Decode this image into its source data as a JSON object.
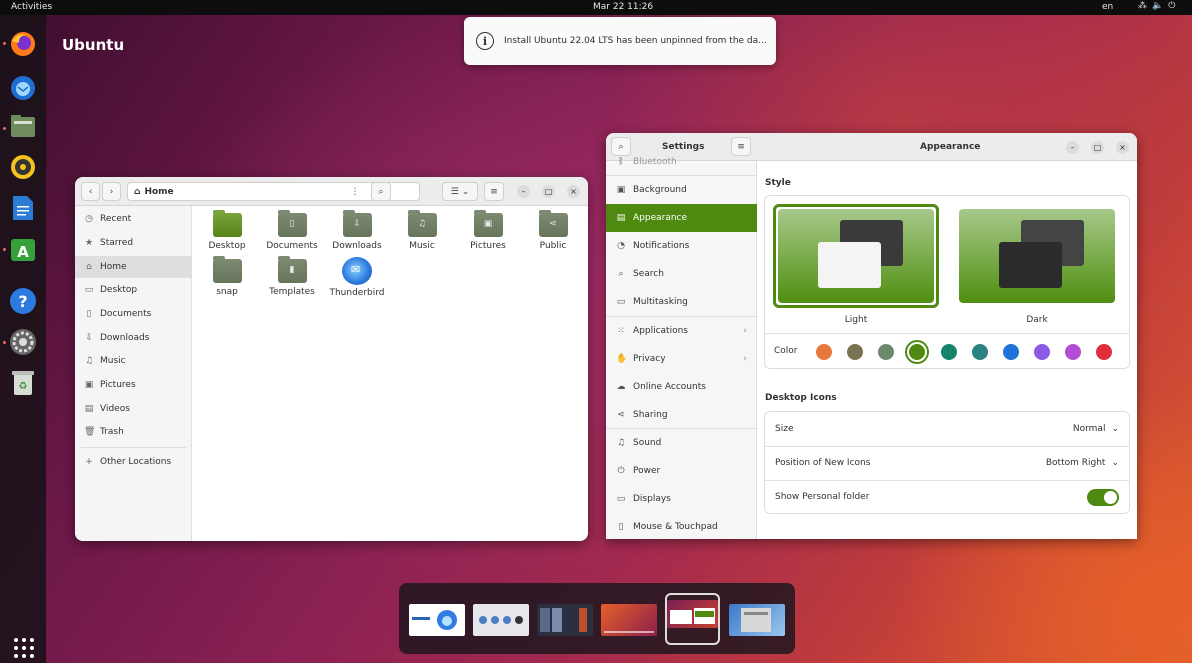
{
  "topbar": {
    "activities": "Activities",
    "clock": "Mar 22  11:26",
    "lang": "en",
    "tray_icons": [
      "network-icon",
      "volume-icon",
      "power-icon"
    ]
  },
  "desktop": {
    "title": "Ubuntu"
  },
  "dock": {
    "apps": [
      "firefox-icon",
      "thunderbird-icon",
      "files-icon",
      "rhythmbox-icon",
      "writer-icon",
      "app-center-icon",
      "help-icon",
      "settings-icon",
      "trash-icon"
    ]
  },
  "notification": {
    "text": "Install Ubuntu 22.04 LTS has been unpinned from the da..."
  },
  "files": {
    "path": "Home",
    "sidebar": [
      {
        "label": "Recent",
        "icon": "clock-icon"
      },
      {
        "label": "Starred",
        "icon": "star-icon"
      },
      {
        "label": "Home",
        "icon": "home-icon"
      },
      {
        "label": "Desktop",
        "icon": "desktop-icon"
      },
      {
        "label": "Documents",
        "icon": "document-icon"
      },
      {
        "label": "Downloads",
        "icon": "download-icon"
      },
      {
        "label": "Music",
        "icon": "music-icon"
      },
      {
        "label": "Pictures",
        "icon": "picture-icon"
      },
      {
        "label": "Videos",
        "icon": "video-icon"
      },
      {
        "label": "Trash",
        "icon": "trash-icon"
      },
      {
        "label": "Other Locations",
        "icon": "plus-icon"
      }
    ],
    "items": [
      "Desktop",
      "Documents",
      "Downloads",
      "Music",
      "Pictures",
      "Public",
      "snap",
      "Templates",
      "Thunderbird"
    ]
  },
  "settings": {
    "title": "Settings",
    "page_title": "Appearance",
    "nav": [
      "Bluetooth",
      "Background",
      "Appearance",
      "Notifications",
      "Search",
      "Multitasking",
      "Applications",
      "Privacy",
      "Online Accounts",
      "Sharing",
      "Sound",
      "Power",
      "Displays",
      "Mouse & Touchpad"
    ],
    "style_label": "Style",
    "themes": [
      "Light",
      "Dark"
    ],
    "selected_theme": "Light",
    "color_label": "Color",
    "colors": [
      "#e8773c",
      "#77744f",
      "#6b8a6b",
      "#4e8a0f",
      "#13846a",
      "#2d8286",
      "#1f72d6",
      "#8a5ae6",
      "#b34cd4",
      "#de2e3e"
    ],
    "selected_color": "#4e8a0f",
    "desktop_icons_label": "Desktop Icons",
    "size_label": "Size",
    "size_value": "Normal",
    "position_label": "Position of New Icons",
    "position_value": "Bottom Right",
    "personal_folder_label": "Show Personal folder",
    "personal_folder_on": true
  },
  "switcher": {
    "windows": [
      "Thunderbird",
      "Files",
      "Phone",
      "Desktop",
      "Settings",
      "Install"
    ],
    "selected_index": 4
  }
}
